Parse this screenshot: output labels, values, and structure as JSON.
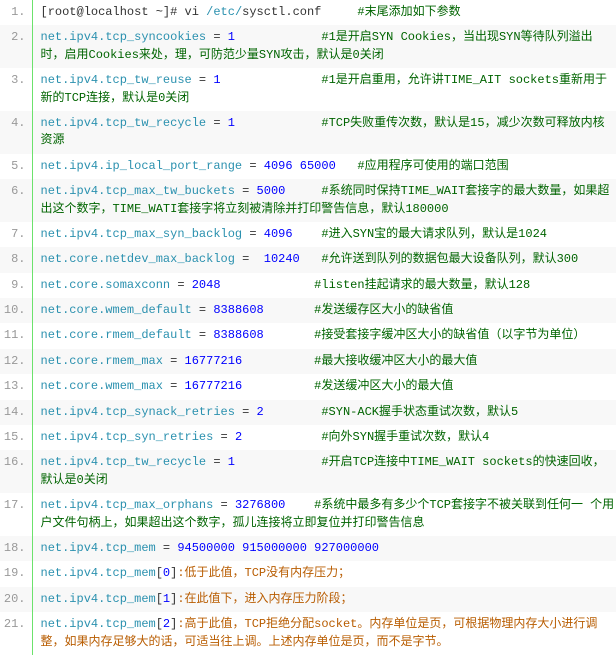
{
  "lines": [
    {
      "n": "1.",
      "segs": [
        {
          "c": "plain",
          "t": "[root@localhost ~]# vi "
        },
        {
          "c": "teal",
          "t": "/etc/"
        },
        {
          "c": "plain",
          "t": "sysctl.conf"
        },
        {
          "c": "green",
          "t": "     #末尾添加如下参数"
        }
      ]
    },
    {
      "n": "2.",
      "segs": [
        {
          "c": "teal",
          "t": "net.ipv4.tcp_syncookies"
        },
        {
          "c": "plain",
          "t": " = "
        },
        {
          "c": "blue",
          "t": "1"
        },
        {
          "c": "green",
          "t": "            #1是开启SYN Cookies，当出现SYN等待队列溢出时，启用Cookies来处，理，可防范少量SYN攻击，默认是0关闭"
        }
      ]
    },
    {
      "n": "3.",
      "segs": [
        {
          "c": "teal",
          "t": "net.ipv4.tcp_tw_reuse"
        },
        {
          "c": "plain",
          "t": " = "
        },
        {
          "c": "blue",
          "t": "1"
        },
        {
          "c": "green",
          "t": "              #1是开启重用，允许讲TIME_AIT sockets重新用于新的TCP连接，默认是0关闭"
        }
      ]
    },
    {
      "n": "4.",
      "segs": [
        {
          "c": "teal",
          "t": "net.ipv4.tcp_tw_recycle"
        },
        {
          "c": "plain",
          "t": " = "
        },
        {
          "c": "blue",
          "t": "1"
        },
        {
          "c": "green",
          "t": "            #TCP失败重传次数，默认是15，减少次数可释放内核资源"
        }
      ]
    },
    {
      "n": "5.",
      "segs": [
        {
          "c": "teal",
          "t": "net.ipv4.ip_local_port_range"
        },
        {
          "c": "plain",
          "t": " = "
        },
        {
          "c": "blue",
          "t": "4096"
        },
        {
          "c": "plain",
          "t": " "
        },
        {
          "c": "blue",
          "t": "65000"
        },
        {
          "c": "green",
          "t": "   #应用程序可使用的端口范围"
        }
      ]
    },
    {
      "n": "6.",
      "segs": [
        {
          "c": "teal",
          "t": "net.ipv4.tcp_max_tw_buckets"
        },
        {
          "c": "plain",
          "t": " = "
        },
        {
          "c": "blue",
          "t": "5000"
        },
        {
          "c": "green",
          "t": "     #系统同时保持TIME_WAIT套接字的最大数量，如果超出这个数字，TIME_WATI套接字将立刻被清除并打印警告信息，默认180000"
        }
      ]
    },
    {
      "n": "7.",
      "segs": [
        {
          "c": "teal",
          "t": "net.ipv4.tcp_max_syn_backlog"
        },
        {
          "c": "plain",
          "t": " = "
        },
        {
          "c": "blue",
          "t": "4096"
        },
        {
          "c": "green",
          "t": "    #进入SYN宝的最大请求队列，默认是1024"
        }
      ]
    },
    {
      "n": "8.",
      "segs": [
        {
          "c": "teal",
          "t": "net.core.netdev_max_backlog"
        },
        {
          "c": "plain",
          "t": " =  "
        },
        {
          "c": "blue",
          "t": "10240"
        },
        {
          "c": "green",
          "t": "   #允许送到队列的数据包最大设备队列，默认300"
        }
      ]
    },
    {
      "n": "9.",
      "segs": [
        {
          "c": "teal",
          "t": "net.core.somaxconn"
        },
        {
          "c": "plain",
          "t": " = "
        },
        {
          "c": "blue",
          "t": "2048"
        },
        {
          "c": "green",
          "t": "             #listen挂起请求的最大数量，默认128"
        }
      ]
    },
    {
      "n": "10.",
      "segs": [
        {
          "c": "teal",
          "t": "net.core.wmem_default"
        },
        {
          "c": "plain",
          "t": " = "
        },
        {
          "c": "blue",
          "t": "8388608"
        },
        {
          "c": "green",
          "t": "       #发送缓存区大小的缺省值"
        }
      ]
    },
    {
      "n": "11.",
      "segs": [
        {
          "c": "teal",
          "t": "net.core.rmem_default"
        },
        {
          "c": "plain",
          "t": " = "
        },
        {
          "c": "blue",
          "t": "8388608"
        },
        {
          "c": "green",
          "t": "       #接受套接字缓冲区大小的缺省值（以字节为单位）"
        }
      ]
    },
    {
      "n": "12.",
      "segs": [
        {
          "c": "teal",
          "t": "net.core.rmem_max"
        },
        {
          "c": "plain",
          "t": " = "
        },
        {
          "c": "blue",
          "t": "16777216"
        },
        {
          "c": "green",
          "t": "          #最大接收缓冲区大小的最大值"
        }
      ]
    },
    {
      "n": "13.",
      "segs": [
        {
          "c": "teal",
          "t": "net.core.wmem_max"
        },
        {
          "c": "plain",
          "t": " = "
        },
        {
          "c": "blue",
          "t": "16777216"
        },
        {
          "c": "green",
          "t": "          #发送缓冲区大小的最大值"
        }
      ]
    },
    {
      "n": "14.",
      "segs": [
        {
          "c": "teal",
          "t": "net.ipv4.tcp_synack_retries"
        },
        {
          "c": "plain",
          "t": " = "
        },
        {
          "c": "blue",
          "t": "2"
        },
        {
          "c": "green",
          "t": "        #SYN-ACK握手状态重试次数，默认5"
        }
      ]
    },
    {
      "n": "15.",
      "segs": [
        {
          "c": "teal",
          "t": "net.ipv4.tcp_syn_retries"
        },
        {
          "c": "plain",
          "t": " = "
        },
        {
          "c": "blue",
          "t": "2"
        },
        {
          "c": "green",
          "t": "           #向外SYN握手重试次数，默认4"
        }
      ]
    },
    {
      "n": "16.",
      "segs": [
        {
          "c": "teal",
          "t": "net.ipv4.tcp_tw_recycle"
        },
        {
          "c": "plain",
          "t": " = "
        },
        {
          "c": "blue",
          "t": "1"
        },
        {
          "c": "green",
          "t": "            #开启TCP连接中TIME_WAIT sockets的快速回收，默认是0关闭"
        }
      ]
    },
    {
      "n": "17.",
      "segs": [
        {
          "c": "teal",
          "t": "net.ipv4.tcp_max_orphans"
        },
        {
          "c": "plain",
          "t": " = "
        },
        {
          "c": "blue",
          "t": "3276800"
        },
        {
          "c": "green",
          "t": "    #系统中最多有多少个TCP套接字不被关联到任何一 个用户文件句柄上，如果超出这个数字，孤儿连接将立即复位并打印警告信息"
        }
      ]
    },
    {
      "n": "18.",
      "segs": [
        {
          "c": "teal",
          "t": "net.ipv4.tcp_mem"
        },
        {
          "c": "plain",
          "t": " = "
        },
        {
          "c": "blue",
          "t": "94500000"
        },
        {
          "c": "plain",
          "t": " "
        },
        {
          "c": "blue",
          "t": "915000000"
        },
        {
          "c": "plain",
          "t": " "
        },
        {
          "c": "blue",
          "t": "927000000"
        }
      ]
    },
    {
      "n": "19.",
      "segs": [
        {
          "c": "teal",
          "t": "net.ipv4.tcp_mem"
        },
        {
          "c": "plain",
          "t": "["
        },
        {
          "c": "blue",
          "t": "0"
        },
        {
          "c": "plain",
          "t": "]"
        },
        {
          "c": "orange",
          "t": ":低于此值，TCP没有内存压力；"
        }
      ]
    },
    {
      "n": "20.",
      "segs": [
        {
          "c": "teal",
          "t": "net.ipv4.tcp_mem"
        },
        {
          "c": "plain",
          "t": "["
        },
        {
          "c": "blue",
          "t": "1"
        },
        {
          "c": "plain",
          "t": "]"
        },
        {
          "c": "orange",
          "t": ":在此值下，进入内存压力阶段；"
        }
      ]
    },
    {
      "n": "21.",
      "segs": [
        {
          "c": "teal",
          "t": "net.ipv4.tcp_mem"
        },
        {
          "c": "plain",
          "t": "["
        },
        {
          "c": "blue",
          "t": "2"
        },
        {
          "c": "plain",
          "t": "]"
        },
        {
          "c": "orange",
          "t": ":高于此值，TCP拒绝分配socket。内存单位是页，可根据物理内存大小进行调整，如果内存足够大的话，可适当往上调。上述内存单位是页，而不是字节。"
        }
      ]
    }
  ]
}
